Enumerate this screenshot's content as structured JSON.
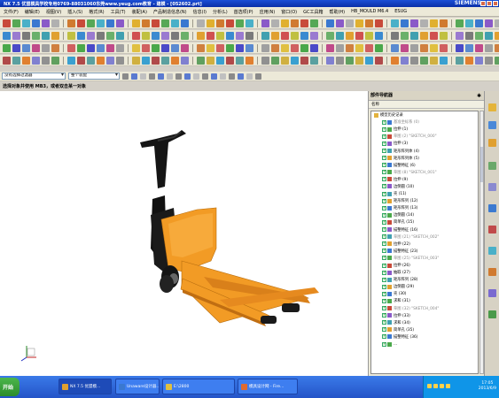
{
  "window": {
    "title": "NX 7.5 优盟模具学校专用0769-88031060东莞www.yeug.com教育 - 建模 - [052602.prt]",
    "brand": "SIEMENS"
  },
  "menu": {
    "items": [
      "文件(F)",
      "编辑(E)",
      "视图(V)",
      "插入(S)",
      "格式(R)",
      "工具(T)",
      "装配(A)",
      "产品制造信息(N)",
      "信息(I)",
      "分析(L)",
      "首选项(P)",
      "应用(N)",
      "窗口(O)",
      "GC工具箱",
      "帮助(H)",
      "HB_MOULD M6.4",
      "ESUG"
    ]
  },
  "selection": {
    "filter": "没有选择过滤器",
    "scope": "整个装配"
  },
  "status": {
    "prompt": "选择对象并使用 MB3，或者双击某一对象"
  },
  "navigator": {
    "title": "部件导航器",
    "column": "名称",
    "rows": [
      {
        "label": "模型历史记录",
        "gray": false,
        "top": true
      },
      {
        "label": "基准坐标系 (0)",
        "gray": true
      },
      {
        "label": "拉伸 (1)",
        "gray": false
      },
      {
        "label": "草图 (2) \"SKETCH_000\"",
        "gray": true
      },
      {
        "label": "拉伸 (3)",
        "gray": false
      },
      {
        "label": "矩形阵列体 (4)",
        "gray": false
      },
      {
        "label": "矩形阵列体 (5)",
        "gray": false
      },
      {
        "label": "描整特征 (6)",
        "gray": false
      },
      {
        "label": "草图 (8) \"SKETCH_001\"",
        "gray": true
      },
      {
        "label": "拉伸 (9)",
        "gray": false
      },
      {
        "label": "边倒圆 (10)",
        "gray": false
      },
      {
        "label": "壳 (11)",
        "gray": false
      },
      {
        "label": "矩形阵列 (12)",
        "gray": false
      },
      {
        "label": "矩形阵列 (13)",
        "gray": false
      },
      {
        "label": "边倒圆 (14)",
        "gray": false
      },
      {
        "label": "简单孔 (15)",
        "gray": false
      },
      {
        "label": "描整特征 (16)",
        "gray": false
      },
      {
        "label": "草图 (21) \"SKETCH_002\"",
        "gray": true
      },
      {
        "label": "拉伸 (22)",
        "gray": false
      },
      {
        "label": "描整特征 (23)",
        "gray": false
      },
      {
        "label": "草图 (25) \"SKETCH_003\"",
        "gray": true
      },
      {
        "label": "拉伸 (26)",
        "gray": false
      },
      {
        "label": "抽取 (27)",
        "gray": false
      },
      {
        "label": "矩形阵列 (28)",
        "gray": false
      },
      {
        "label": "边倒圆 (29)",
        "gray": false
      },
      {
        "label": "壳 (30)",
        "gray": false
      },
      {
        "label": "求和 (31)",
        "gray": false
      },
      {
        "label": "草图 (32) \"SKETCH_004\"",
        "gray": true
      },
      {
        "label": "拉伸 (33)",
        "gray": false
      },
      {
        "label": "求和 (34)",
        "gray": false
      },
      {
        "label": "简单孔 (35)",
        "gray": false
      },
      {
        "label": "描整特征 (36)",
        "gray": false
      },
      {
        "label": "...",
        "gray": false
      }
    ]
  },
  "taskbar": {
    "start": "开始",
    "tasks": [
      "NX 7.5 优盟模...",
      "Unaware设计器...",
      "E:\\2800",
      "模具设计网 - Fire..."
    ],
    "clock_time": "17:05",
    "clock_date": "2013/6/9"
  },
  "colors": {
    "accent_orange": "#f29b25",
    "title_blue": "#0a2fa8",
    "taskbar_blue": "#2454c8"
  }
}
